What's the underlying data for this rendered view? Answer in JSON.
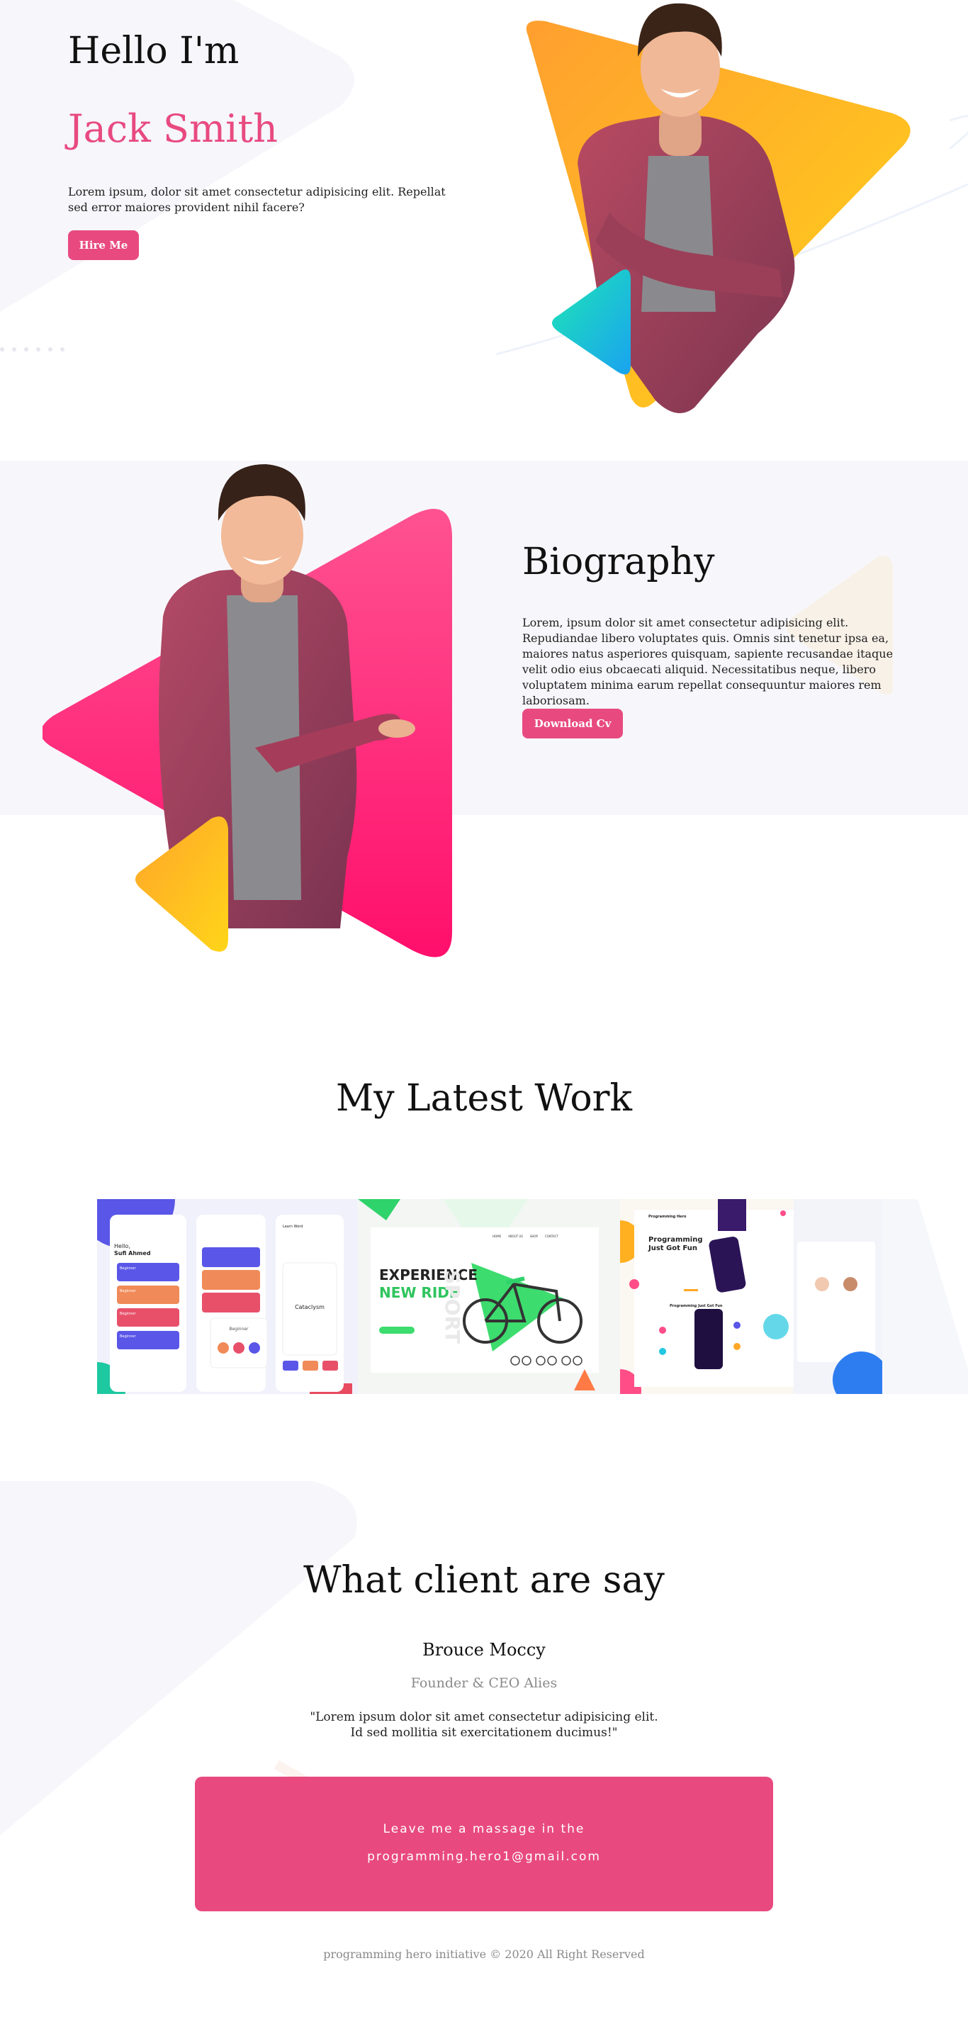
{
  "hero": {
    "greeting": "Hello I'm",
    "name": "Jack Smith",
    "description": "Lorem ipsum, dolor sit amet consectetur adipisicing elit. Repellat sed error maiores provident nihil facere?",
    "button_label": "Hire Me"
  },
  "biography": {
    "title": "Biography",
    "text": "Lorem, ipsum dolor sit amet consectetur adipisicing elit. Repudiandae libero voluptates quis. Omnis sint tenetur ipsa ea, maiores natus asperiores quisquam, sapiente recusandae itaque velit odio eius obcaecati aliquid. Necessitatibus neque, libero voluptatem minima earum repellat consequuntur maiores rem laboriosam.",
    "button_label": "Download Cv"
  },
  "work": {
    "title": "My Latest Work",
    "cards": [
      {
        "greeting": "Hello,",
        "user": "Sufi Ahmed",
        "items": [
          "Beginner",
          "Beginner",
          "Beginner",
          "Beginner"
        ],
        "screen_title": "Learn Word",
        "word": "Cataclysm",
        "level": "Beginner"
      },
      {
        "headline_1": "EXPERIENCE",
        "headline_2": "NEW RIDE",
        "side_text": "SPORT",
        "nav": [
          "HOME",
          "ABOUT US",
          "SHOP",
          "CONTACT"
        ]
      },
      {
        "brand": "Programming Hero",
        "headline": "Programming Just Got Fun",
        "section_title": "Programming Just Got Fun"
      }
    ]
  },
  "testimonial": {
    "title": "What client are say",
    "client_name": "Brouce Moccy",
    "client_role": "Founder & CEO Alies",
    "quote": "\"Lorem ipsum dolor sit amet consectetur adipisicing elit. Id sed mollitia sit exercitationem ducimus!\""
  },
  "contact": {
    "line1": "Leave me a massage in the",
    "line2": "programming.hero1@gmail.com"
  },
  "footer": {
    "text": "programming hero initiative © 2020 All Right Reserved"
  },
  "colors": {
    "accent": "#e84a7f",
    "orange": "#ffa726",
    "yellow": "#ffcc1c",
    "teal": "#22d3b8",
    "pink": "#ff2c79",
    "band": "#f7f7fb"
  },
  "icons": [
    "person-photo",
    "triangle-shape",
    "bicycle-icon"
  ]
}
